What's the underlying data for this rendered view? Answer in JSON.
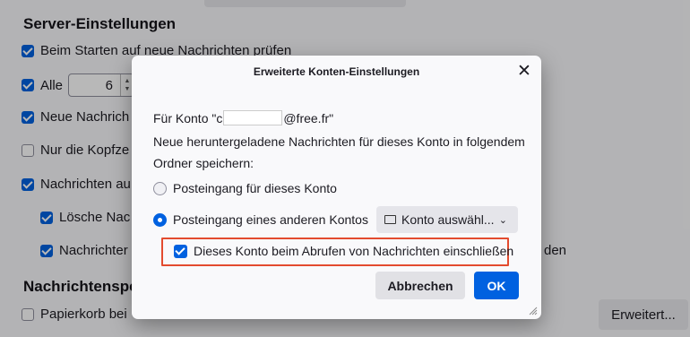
{
  "background": {
    "section1_title": "Server-Einstellungen",
    "check_new_on_start": "Beim Starten auf neue Nachrichten prüfen",
    "every_label": "Alle",
    "every_value": "6",
    "new_messages_label": "Neue Nachrich",
    "headers_only_label": "Nur die Kopfze",
    "messages_on_label": "Nachrichten au",
    "delete_label": "Lösche Nac",
    "messages2_label": "Nachrichter",
    "messages2_suffix": "den",
    "section2_title": "Nachrichtenspe",
    "trash_label": "Papierkorb bei",
    "advanced_button": "Erweitert..."
  },
  "dialog": {
    "title": "Erweiterte Konten-Einstellungen",
    "close_symbol": "✕",
    "account_prefix": "Für Konto \"",
    "account_visible_char": "c",
    "account_suffix": "@free.fr\"",
    "description_line1": "Neue heruntergeladene Nachrichten für dieses Konto in folgendem",
    "description_line2": "Ordner speichern:",
    "radio_inbox_label": "Posteingang für dieses Konto",
    "radio_other_label": "Posteingang eines anderen Kontos",
    "folder_select_label": "Konto auswähl...",
    "include_checkbox_label": "Dieses Konto beim Abrufen von Nachrichten einschließen",
    "cancel_label": "Abbrechen",
    "ok_label": "OK"
  },
  "colors": {
    "accent": "#0061e0",
    "highlight": "#e34b2f"
  }
}
